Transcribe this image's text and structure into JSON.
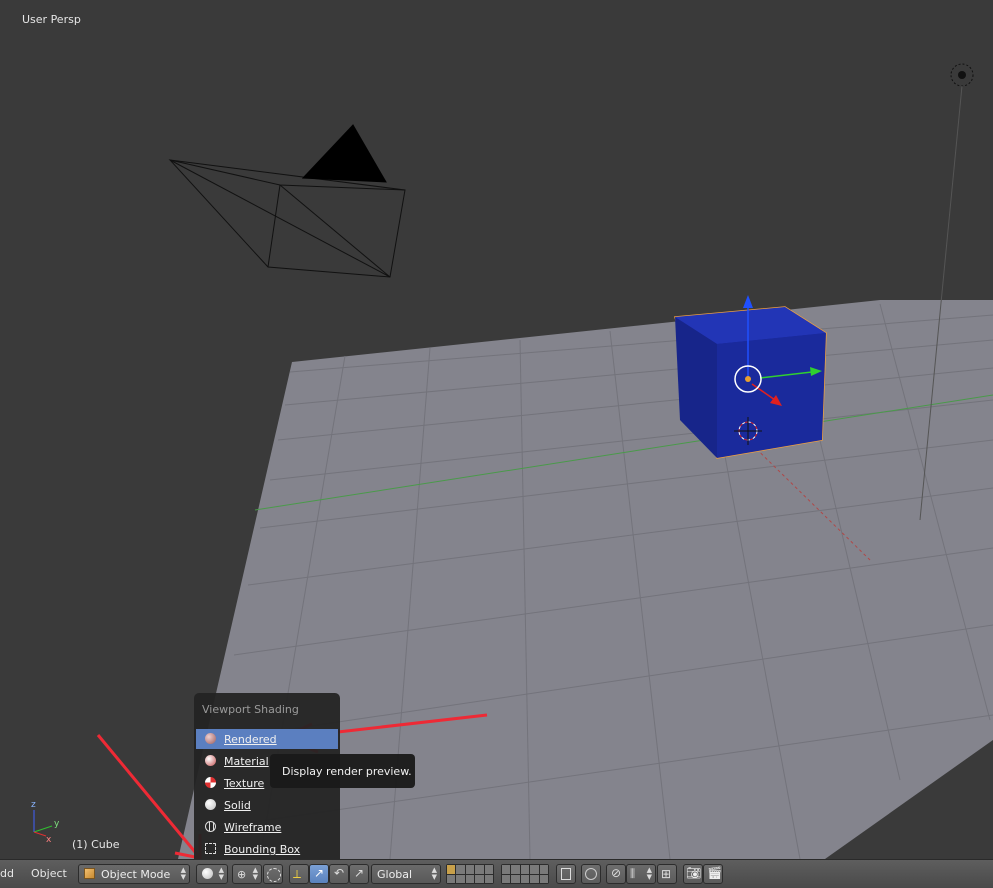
{
  "viewport": {
    "view_label": "User Persp",
    "object_label": "(1) Cube",
    "axis_labels": [
      "z",
      "y",
      "x"
    ]
  },
  "header": {
    "menus": [
      "dd",
      "Object"
    ],
    "mode": {
      "label": "Object Mode",
      "icon": "cube-icon"
    },
    "shading_icon": "solid-sphere-icon",
    "transform_orientation": "Global"
  },
  "shading_menu": {
    "title": "Viewport Shading",
    "items": [
      {
        "label": "Rendered",
        "icon": "rendered-sphere-icon",
        "selected": true
      },
      {
        "label": "Material",
        "icon": "material-sphere-icon",
        "selected": false
      },
      {
        "label": "Texture",
        "icon": "texture-checker-icon",
        "selected": false
      },
      {
        "label": "Solid",
        "icon": "solid-sphere-icon",
        "selected": false
      },
      {
        "label": "Wireframe",
        "icon": "wireframe-sphere-icon",
        "selected": false
      },
      {
        "label": "Bounding Box",
        "icon": "bounding-box-icon",
        "selected": false
      }
    ]
  },
  "tooltip": {
    "text": "Display render preview."
  },
  "colors": {
    "cube": "#1a2a9c",
    "floor": "#83838c",
    "selection_outline": "#f0a040",
    "highlight": "#5b7fc0",
    "annotation_arrow": "#ee2a35"
  }
}
